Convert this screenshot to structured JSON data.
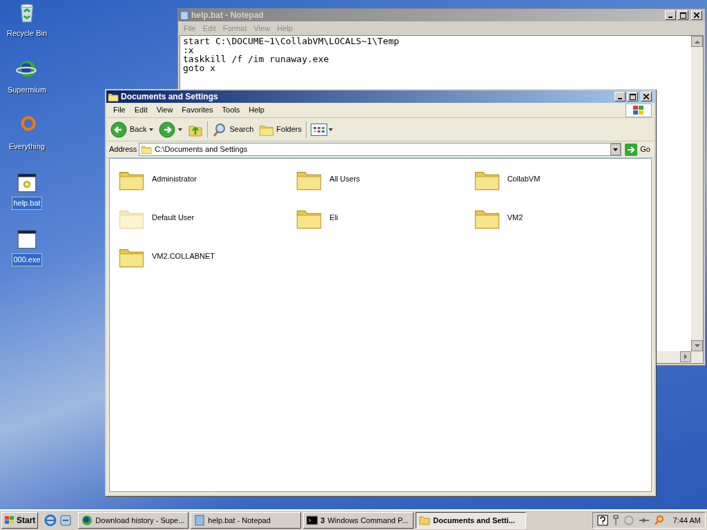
{
  "desktop_icons": [
    {
      "label": "Recycle Bin",
      "kind": "recycle",
      "selected": false
    },
    {
      "label": "Supermium",
      "kind": "browser",
      "selected": false
    },
    {
      "label": "Everything",
      "kind": "ring",
      "selected": false
    },
    {
      "label": "help.bat",
      "kind": "batch",
      "selected": true
    },
    {
      "label": "000.exe",
      "kind": "exe",
      "selected": true
    }
  ],
  "notepad": {
    "title": "help.bat - Notepad",
    "active": false,
    "menu": [
      "File",
      "Edit",
      "Format",
      "View",
      "Help"
    ],
    "lines": [
      "start C:\\DOCUME~1\\CollabVM\\LOCALS~1\\Temp",
      ":x",
      "taskkill /f /im runaway.exe",
      "goto x"
    ]
  },
  "explorer": {
    "title": "Documents and Settings",
    "active": true,
    "menu": [
      "File",
      "Edit",
      "View",
      "Favorites",
      "Tools",
      "Help"
    ],
    "toolbar": {
      "back": "Back",
      "search": "Search",
      "folders": "Folders"
    },
    "address": {
      "label": "Address",
      "value": "C:\\Documents and Settings",
      "go": "Go"
    },
    "folders": [
      {
        "name": "Administrator",
        "hidden": false
      },
      {
        "name": "All Users",
        "hidden": false
      },
      {
        "name": "CollabVM",
        "hidden": false
      },
      {
        "name": "Default User",
        "hidden": true
      },
      {
        "name": "Eli",
        "hidden": false
      },
      {
        "name": "VM2",
        "hidden": false
      },
      {
        "name": "VM2.COLLABNET",
        "hidden": false
      }
    ]
  },
  "taskbar": {
    "start": "Start",
    "buttons": [
      {
        "label": "Download history - Supe...",
        "kind": "browser",
        "selected": false
      },
      {
        "label": "help.bat - Notepad",
        "kind": "notepad",
        "selected": false
      },
      {
        "label": "Windows Command P...",
        "count": "3",
        "kind": "cmd",
        "selected": false
      },
      {
        "label": "Documents and Setti...",
        "kind": "folder",
        "selected": true
      }
    ],
    "clock": "7:44 AM"
  }
}
